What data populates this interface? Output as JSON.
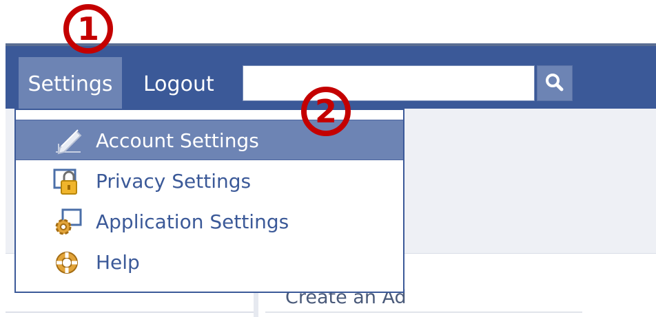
{
  "header": {
    "settings_label": "Settings",
    "logout_label": "Logout",
    "search": {
      "value": "",
      "placeholder": ""
    }
  },
  "dropdown": {
    "items": [
      {
        "label": "Account Settings",
        "icon": "pencil-icon",
        "selected": true
      },
      {
        "label": "Privacy Settings",
        "icon": "lock-icon",
        "selected": false
      },
      {
        "label": "Application Settings",
        "icon": "gear-icon",
        "selected": false
      },
      {
        "label": "Help",
        "icon": "lifebuoy-icon",
        "selected": false
      }
    ]
  },
  "main": {
    "create_ad_label": "Create an Ad"
  },
  "annotations": {
    "step1": "1",
    "step2": "2"
  },
  "colors": {
    "header_blue": "#3b5998",
    "highlight_blue": "#6d84b4",
    "annotation_red": "#c40000"
  }
}
